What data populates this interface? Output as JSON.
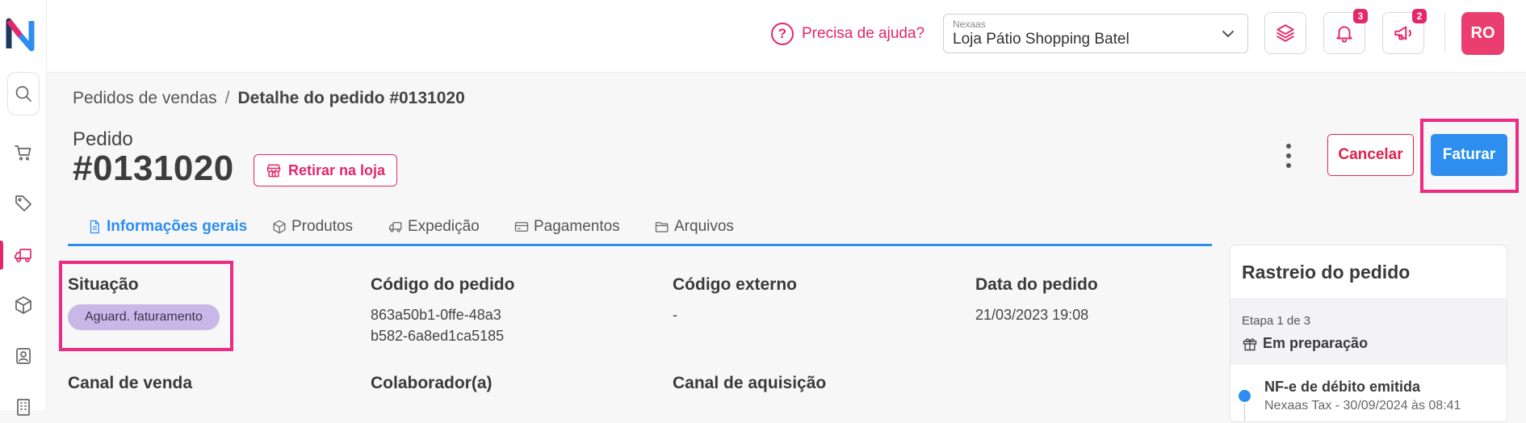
{
  "topbar": {
    "help_label": "Precisa de ajuda?",
    "help_icon": "question-circle-icon",
    "store_select": {
      "caption": "Nexaas",
      "value": "Loja Pátio Shopping Batel"
    },
    "notifications_badge": "3",
    "announcements_badge": "2",
    "avatar_initials": "RO"
  },
  "sidebar": {
    "items": [
      {
        "name": "search",
        "icon": "search-icon"
      },
      {
        "name": "cart",
        "icon": "cart-icon"
      },
      {
        "name": "tags",
        "icon": "tag-icon"
      },
      {
        "name": "orders",
        "icon": "truck-icon",
        "active": true
      },
      {
        "name": "products",
        "icon": "box-icon"
      },
      {
        "name": "contacts",
        "icon": "contact-icon"
      },
      {
        "name": "company",
        "icon": "building-icon"
      }
    ]
  },
  "breadcrumb": {
    "parent": "Pedidos de vendas",
    "separator": "/",
    "current": "Detalhe do pedido #0131020"
  },
  "order": {
    "label": "Pedido",
    "number": "#0131020",
    "pickup_label": "Retirar na loja",
    "cancel_label": "Cancelar",
    "invoice_label": "Faturar"
  },
  "tabs": [
    {
      "label": "Informações gerais",
      "icon": "document-icon",
      "active": true
    },
    {
      "label": "Produtos",
      "icon": "box-icon"
    },
    {
      "label": "Expedição",
      "icon": "truck-icon"
    },
    {
      "label": "Pagamentos",
      "icon": "credit-card-icon"
    },
    {
      "label": "Arquivos",
      "icon": "folder-icon"
    }
  ],
  "fields": {
    "situacao": {
      "label": "Situação",
      "value": "Aguard. faturamento"
    },
    "codigo_pedido": {
      "label": "Código do pedido",
      "line1": "863a50b1-0ffe-48a3",
      "line2": "b582-6a8ed1ca5185"
    },
    "codigo_externo": {
      "label": "Código externo",
      "value": "-"
    },
    "data_pedido": {
      "label": "Data do pedido",
      "value": "21/03/2023 19:08"
    },
    "canal_venda": {
      "label": "Canal de venda"
    },
    "colaborador": {
      "label": "Colaborador(a)"
    },
    "canal_aquisicao": {
      "label": "Canal de aquisição"
    }
  },
  "tracking": {
    "title": "Rastreio do pedido",
    "stage_step": "Etapa 1 de 3",
    "stage_name": "Em preparação",
    "event_title": "NF-e de débito emitida",
    "event_sub": "Nexaas Tax - 30/09/2024 às 08:41"
  },
  "colors": {
    "brand_pink": "#e5266a",
    "primary_blue": "#2d8ef0",
    "status_pill": "#c9b8e7"
  }
}
